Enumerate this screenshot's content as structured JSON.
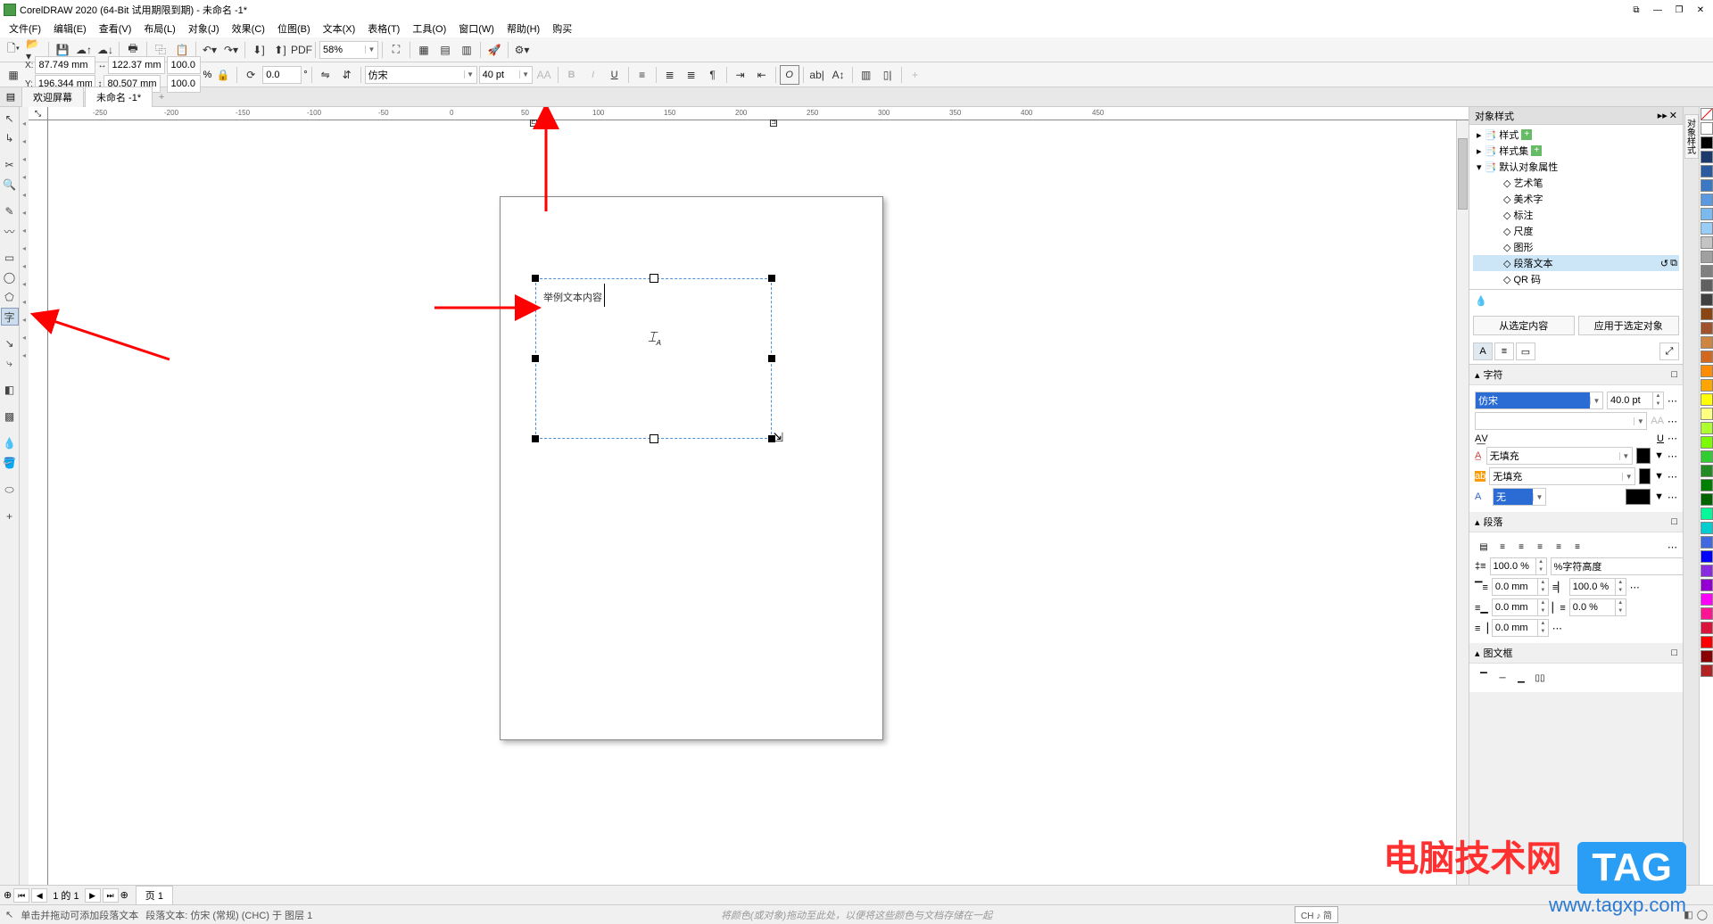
{
  "title": "CorelDRAW 2020 (64-Bit 试用期限到期) - 未命名 -1*",
  "menus": [
    "文件(F)",
    "编辑(E)",
    "查看(V)",
    "布局(L)",
    "对象(J)",
    "效果(C)",
    "位图(B)",
    "文本(X)",
    "表格(T)",
    "工具(O)",
    "窗口(W)",
    "帮助(H)",
    "购买"
  ],
  "zoom": "58%",
  "coords": {
    "x": "87.749 mm",
    "y": "196.344 mm",
    "w": "122.37 mm",
    "h": "80.507 mm",
    "sx": "100.0",
    "sy": "100.0",
    "pct": "%",
    "rot": "0.0",
    "deg": "°"
  },
  "font": {
    "name": "仿宋",
    "size": "40 pt"
  },
  "tabs": {
    "welcome": "欢迎屏幕",
    "doc": "未命名 -1*"
  },
  "ruler_ticks": [
    "-250",
    "-200",
    "-150",
    "-100",
    "-50",
    "0",
    "50",
    "100",
    "150",
    "200",
    "250",
    "300",
    "350",
    "400",
    "450"
  ],
  "text_content": "举例文本内容",
  "page_nav": {
    "info": "1 的 1",
    "page_label": "页 1"
  },
  "status": {
    "hint": "单击并拖动可添加段落文本",
    "detail": "段落文本: 仿宋 (常规) (CHC) 于 图层 1",
    "color_hint": "将颜色(或对象)拖动至此处，以便将这些颜色与文档存储在一起",
    "ime": "CH ♪ 简"
  },
  "docker": {
    "title": "对象样式",
    "tree_lv1a": "样式",
    "tree_lv1b": "样式集",
    "tree_lv1c": "默认对象属性",
    "tree_items": [
      "艺术笔",
      "美术字",
      "标注",
      "尺度",
      "图形",
      "段落文本",
      "QR 码"
    ],
    "btn_from": "从选定内容",
    "btn_apply": "应用于选定对象",
    "sec_char": "字符",
    "sec_para": "段落",
    "sec_frame": "图文框",
    "char_font": "仿宋",
    "char_size": "40.0 pt",
    "fill1": "无填充",
    "fill2": "无填充",
    "fill3": "无",
    "para_indent": "100.0 %",
    "para_height_label": "%字符高度",
    "para_sp1": "0.0 mm",
    "para_sp2": "100.0 %",
    "para_sp3": "0.0 mm",
    "para_sp4": "0.0 %",
    "para_sp5": "0.0 mm"
  },
  "palette": [
    "#ffffff",
    "#000000",
    "#1a3a6e",
    "#2a5aa0",
    "#3a7ac4",
    "#5a9ae0",
    "#7abaf0",
    "#9acef8",
    "#c4c4c4",
    "#a0a0a0",
    "#808080",
    "#606060",
    "#404040",
    "#8b4513",
    "#a0522d",
    "#cd853f",
    "#d2691e",
    "#ff8c00",
    "#ffa500",
    "#ffff00",
    "#ffff80",
    "#adff2f",
    "#7cfc00",
    "#32cd32",
    "#228b22",
    "#008000",
    "#006400",
    "#00fa9a",
    "#00ced1",
    "#4169e1",
    "#0000ff",
    "#8a2be2",
    "#9400d3",
    "#ff00ff",
    "#ff1493",
    "#dc143c",
    "#ff0000",
    "#8b0000",
    "#b22222"
  ],
  "side_tab": "对象样式",
  "watermark": {
    "line1": "电脑技术网",
    "line2": "www.tagxp.com",
    "tag": "TAG"
  }
}
